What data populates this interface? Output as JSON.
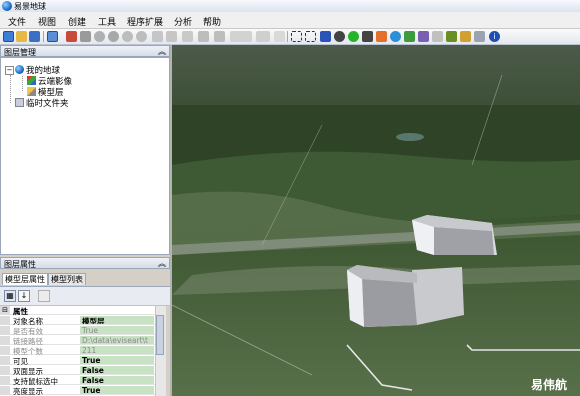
{
  "window": {
    "title": "易景地球"
  },
  "menu": [
    "文件",
    "视图",
    "创建",
    "工具",
    "程序扩展",
    "分析",
    "帮助"
  ],
  "toolbar": {
    "icons": [
      "new-icon",
      "open-icon",
      "save-icon",
      "refresh-icon",
      "tool-icon",
      "move-icon",
      "rotate-icon",
      "orbit-icon",
      "ellipse-icon",
      "line-icon",
      "draw-icon",
      "layers-icon",
      "window-icon",
      "monitor-icon",
      "hline-icon",
      "select-icon",
      "zoom-area-icon",
      "pointer-icon",
      "pan-icon",
      "globe-green-icon",
      "compass-icon",
      "map-icon",
      "search-icon",
      "image-icon",
      "flag-icon",
      "grid-icon",
      "pin-icon",
      "print-icon",
      "info-icon"
    ]
  },
  "layer_panel": {
    "title": "图层管理",
    "tree": [
      {
        "label": "我的地球",
        "level": 0,
        "icon": "globe-icon"
      },
      {
        "label": "云端影像",
        "level": 1,
        "icon": "cloud-imagery-icon"
      },
      {
        "label": "模型层",
        "level": 1,
        "icon": "model-layer-icon"
      },
      {
        "label": "临时文件夹",
        "level": 0,
        "icon": "folder-icon"
      }
    ]
  },
  "properties_panel": {
    "title": "图层属性",
    "tabs": [
      "模型层属性",
      "模型列表"
    ],
    "category": "属性",
    "rows": [
      {
        "key": "对象名称",
        "value": "模型层",
        "disabled": false,
        "bold": true
      },
      {
        "key": "是否有效",
        "value": "True",
        "disabled": true,
        "bold": false
      },
      {
        "key": "链接路径",
        "value": "D:\\data\\eviseart\\t",
        "disabled": true,
        "bold": false
      },
      {
        "key": "模型个数",
        "value": "211",
        "disabled": true,
        "bold": false
      },
      {
        "key": "可见",
        "value": "True",
        "disabled": false,
        "bold": true
      },
      {
        "key": "双面显示",
        "value": "False",
        "disabled": false,
        "bold": true
      },
      {
        "key": "支持鼠标选中",
        "value": "False",
        "disabled": false,
        "bold": true
      },
      {
        "key": "亮度显示",
        "value": "True",
        "disabled": false,
        "bold": true
      }
    ]
  },
  "watermark": "易伟航"
}
